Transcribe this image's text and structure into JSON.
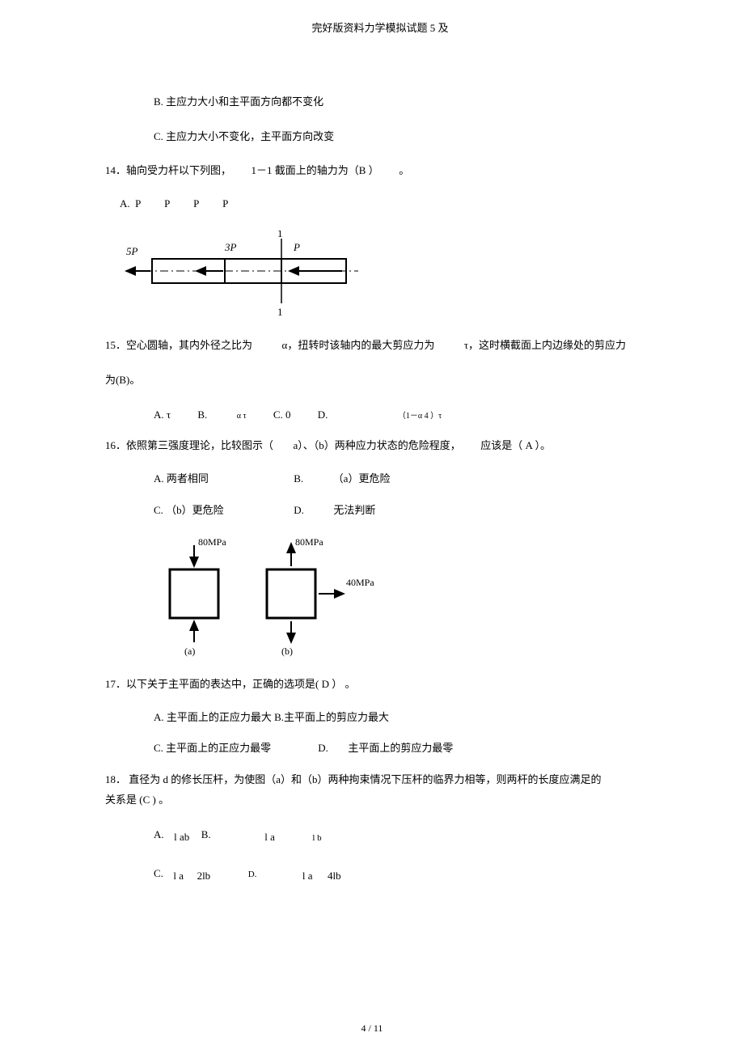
{
  "header": {
    "title": "完好版资料力学模拟试题 5 及"
  },
  "q13": {
    "optB": "B. 主应力大小和主平面方向都不变化",
    "optC": "C. 主应力大小不变化，主平面方向改变"
  },
  "q14": {
    "stem_pre": "14．轴向受力杆以下列图，",
    "stem_mid": "1－1 截面上的轴力为（B ）",
    "stem_post": "。",
    "optARow": "A.  P         P         P         P",
    "fig": {
      "left": "5P",
      "mid": "3P",
      "right": "P",
      "sect": "1"
    }
  },
  "q15": {
    "line1_a": "15．空心圆轴，其内外径之比为",
    "line1_b": "α，扭转时该轴内的最大剪应力为",
    "line1_c": "τ，这时横截面上内边缘处的剪应力",
    "line2": "为(B)。",
    "optA": "A.  τ",
    "optB": "B.",
    "optB_val": "α τ",
    "optC": "C. 0",
    "optD": "D.",
    "optD_val": "（1－α 4 ）τ"
  },
  "q16": {
    "stem_a": "16．依照第三强度理论，比较图示（",
    "stem_b": "a）、（b）两种应力状态的危险程度，",
    "stem_c": "应该是（  A   ）。",
    "optA": "A.  两者相同",
    "optB": "B.",
    "optB_val": "（a）更危险",
    "optC": "C. （b）更危险",
    "optD": "D.",
    "optD_val": "无法判断",
    "fig": {
      "v80a": "80MPa",
      "v80b": "80MPa",
      "v40": "40MPa",
      "la": "(a)",
      "lb": "(b)"
    }
  },
  "q17": {
    "stem": "17．以下关于主平面的表达中，正确的选项是( D ） 。",
    "optA": "A. 主平面上的正应力最大 B.主平面上的剪应力最大",
    "optC": "C. 主平面上的正应力最零",
    "optD": "D.",
    "optD_val": "主平面上的剪应力最零"
  },
  "q18": {
    "line1": "18． 直径为 d 的修长压杆，为使图（a）和（b）两种拘束情况下压杆的临界力相等，则两杆的长度应满足的",
    "line2": "关系是 (C ) 。",
    "row1": {
      "A": "A.",
      "A_val": "l ab",
      "B": "B.",
      "B_la": "l a",
      "B_lb": "l b"
    },
    "row2": {
      "C": "C.",
      "C_la": "l a",
      "C_2lb": "2lb",
      "D": "D.",
      "D_la": "l a",
      "D_4lb": "4lb"
    }
  },
  "footer": {
    "page": "4 / 11"
  }
}
